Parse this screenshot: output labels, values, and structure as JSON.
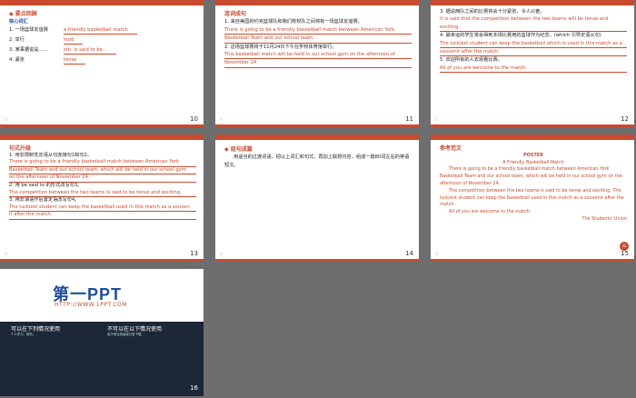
{
  "slides": {
    "s10": {
      "number": "10",
      "header": "◆ 要点回顾",
      "sub": "核心词汇",
      "rows": [
        {
          "q": "1. 一场篮球友谊赛",
          "a": "a friendly basketball match"
        },
        {
          "q": "2. 举行",
          "a": "hold"
        },
        {
          "q": "3. 某事据说是……",
          "a": "sth. is said to be..."
        },
        {
          "q": "4. 紧张",
          "a": "tense"
        }
      ]
    },
    "s11": {
      "number": "11",
      "header": "连词成句",
      "l1": "1. 来自美国的约克篮球队和我们校校队之间将有一场篮球友谊赛。",
      "a1": "There is going to be a friendly basketball match between American York",
      "a1b": "Basketball Team and our school team.",
      "l2": "2. 这场篮球赛将于11月24日下午在学校体育馆举行。",
      "a2": "This basketball match will be held in our school gym on the afternoon of",
      "a2b": "November 24."
    },
    "s12": {
      "number": "12",
      "l3": "3. 据说两队之间的比赛将会十分紧张，令人兴奋。",
      "a3": "It is said that the competition between the two teams will be tense and exciting.",
      "l4": "4. 最幸运的学生将会得到本场比赛用的篮球作为纪念。(which 引导定语从句)",
      "a4": "The luckiest student can keep the basketball which is used in this match as a",
      "a4b": "souvenir after the match.",
      "l5": "5. 欢迎所有的人去观看比赛。",
      "a5": "All of you are welcome to the match."
    },
    "s13": {
      "number": "13",
      "header": "句式升级",
      "l1": "1. 用非限制性定语从句连接句1和句2。",
      "a1": "There is going to be a friendly basketball match between American York",
      "a1b": "Basketball Team and our school team, which will be held in our school gym",
      "a1c": "on the afternoon of November 24.",
      "l2": "2. 用 be said to 的形式改写句3。",
      "a2": "The competition between the two teams is said to be tense and exciting.",
      "l3": "3. 用非谓语作后置定语改写句4。",
      "a3": "The luckiest student can keep the basketball used in this match as a souven",
      "a3b": "ir after the match."
    },
    "s14": {
      "number": "14",
      "header": "◆ 组句成篇",
      "text": "用适当的过渡词语，把以上词汇和句式，再加上联想内容，组成一篇80词左右的英语短文。"
    },
    "s15": {
      "number": "15",
      "header": "参考范文",
      "poster": "POSTER",
      "title": "A Friendly Basketball Match",
      "p1": "There is going to be a friendly basketball match between American York Basketball Team and our school team, which will be held in our school gym on the afternoon of November 24.",
      "p2": "The competition between the two teams is said to be tense and exciting. The luckiest student can keep the basketball used in this match as a souvenir after the match.",
      "p3": "All of you are welcome to the match.",
      "sign": "The Students' Union"
    },
    "s16": {
      "number": "16",
      "logo": "第一PPT",
      "url": "HTTP://WWW.1PPT.COM",
      "can_title": "可以在下列情况使用",
      "can_sub": "个人学习、研究。",
      "cannot_title": "不可以在以下情况使用",
      "cannot_sub": "用于商业用途或分发下载。"
    }
  }
}
